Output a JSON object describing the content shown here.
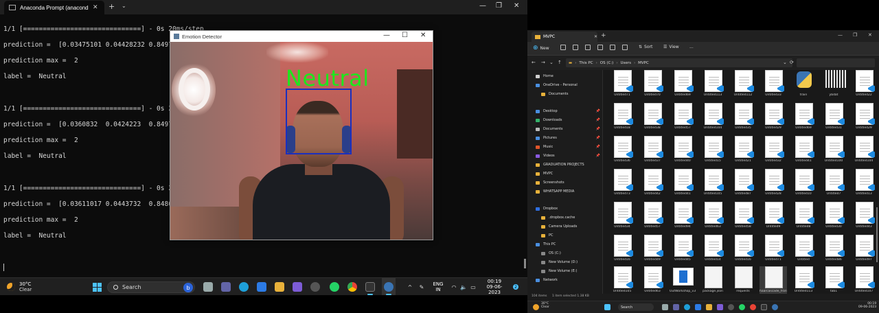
{
  "terminal": {
    "tab_title": "Anaconda Prompt (anaconda",
    "lines": [
      "1/1 [==============================] - 0s 20ms/step",
      "prediction =  [0.03475101 0.04428232 0.8497",
      "prediction max =  2",
      "label =  Neutral",
      "1/1 [==============================] - 0s 2",
      "prediction =  [0.0360832  0.0424223  0.8497",
      "prediction max =  2",
      "label =  Neutral",
      "1/1 [==============================] - 0s 2",
      "prediction =  [0.03611017 0.0443732  0.8486",
      "prediction max =  2",
      "label =  Neutral"
    ]
  },
  "emotion_window": {
    "title": "Emotion Detector",
    "detected_label": "Neutral",
    "label_color": "#1ce81c",
    "box_color": "#1a2fbf"
  },
  "taskbar_left": {
    "temp": "30°C",
    "condition": "Clear",
    "search_placeholder": "Search",
    "lang_top": "ENG",
    "lang_bottom": "IN",
    "time": "00:19",
    "date": "09-06-2023",
    "notif_count": "2"
  },
  "explorer": {
    "tab_title": "MVPC",
    "toolbar": [
      "New",
      "Sort",
      "View",
      "..."
    ],
    "breadcrumb": [
      "This PC",
      "OS (C:)",
      "Users",
      "MVPC"
    ],
    "nav": [
      {
        "label": "Home",
        "color": "#cfcfcf"
      },
      {
        "label": "OneDrive - Personal",
        "color": "#4a8fe0"
      },
      {
        "label": "Documents",
        "color": "#e8b13a"
      },
      {
        "label": "Desktop",
        "color": "#4a8fe0",
        "pin": true
      },
      {
        "label": "Downloads",
        "color": "#35b36b",
        "pin": true
      },
      {
        "label": "Documents",
        "color": "#bbbbbb",
        "pin": true
      },
      {
        "label": "Pictures",
        "color": "#4a8fe0",
        "pin": true
      },
      {
        "label": "Music",
        "color": "#e0552a",
        "pin": true
      },
      {
        "label": "Videos",
        "color": "#8a5ae0",
        "pin": true
      },
      {
        "label": "GRADUATION PROJECTS",
        "color": "#e8b13a"
      },
      {
        "label": "MVPC",
        "color": "#e8b13a"
      },
      {
        "label": "Screenshots",
        "color": "#e8b13a"
      },
      {
        "label": "WHATSAPP MEDIA",
        "color": "#e8b13a"
      },
      {
        "label": "Dropbox",
        "color": "#2f6fe0"
      },
      {
        "label": ".dropbox.cache",
        "color": "#e8b13a"
      },
      {
        "label": "Camera Uploads",
        "color": "#e8b13a"
      },
      {
        "label": "PC",
        "color": "#e8b13a"
      },
      {
        "label": "This PC",
        "color": "#4a8fe0"
      },
      {
        "label": "OS (C:)",
        "color": "#888888"
      },
      {
        "label": "New Volume (D:)",
        "color": "#888888"
      },
      {
        "label": "New Volume (E:)",
        "color": "#888888"
      },
      {
        "label": "Network",
        "color": "#4a8fe0"
      }
    ],
    "files": [
      [
        "Untitled71",
        "Untitled70",
        "Untitled69",
        "Untitled113",
        "Untitled112",
        "Untitled33",
        "train",
        "ybdat",
        "Untitled22"
      ],
      [
        "Untitled18",
        "Untitled38",
        "Untitled57",
        "Untitled104",
        "Untitled35",
        "Untitled29",
        "Untitled69",
        "Untitled31",
        "Untitled29"
      ],
      [
        "Untitled36",
        "Untitled37",
        "Untitled40",
        "Untitled15",
        "Untitled21",
        "Untitled32",
        "Untitled41",
        "Untitled100",
        "Untitled104"
      ],
      [
        "Untitled73",
        "Untitled42",
        "Untitled41",
        "Untitled105",
        "Untitled87",
        "Untitled28",
        "Untitled10",
        "Untitled7",
        "Untitled13"
      ],
      [
        "Untitled34",
        "Untitled57",
        "Untitled94",
        "Untitled63",
        "Untitled58",
        "Untitled9",
        "Untitled8",
        "Untitled30",
        "Untitled43"
      ],
      [
        "Untitled16",
        "Untitled49",
        "Untitled45",
        "Untitled14",
        "Untitled16",
        "Untitled71",
        "Untitled",
        "Untitled86",
        "Untitled97"
      ],
      [
        "Untitled105",
        "Untitled63",
        "OutWorkshop_v3",
        "package.json",
        "requests",
        "haarcascade_frontalface_default.xml",
        "Untitled113",
        "tab1",
        "Untitled107"
      ]
    ],
    "status_items": "104 items",
    "status_selected": "1 item selected 1.38 KB"
  },
  "taskbar_right": {
    "temp": "30°C",
    "condition": "Clear",
    "search_placeholder": "Search",
    "time": "00:19",
    "date": "09-06-2023"
  }
}
